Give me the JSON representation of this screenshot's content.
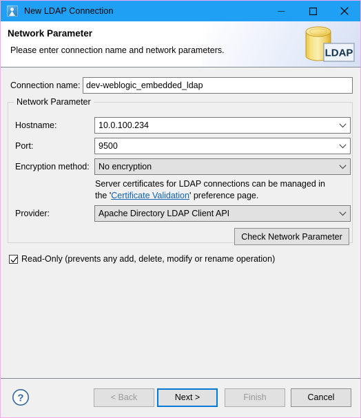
{
  "window": {
    "title": "New LDAP Connection",
    "app_icon": "ldap-app-icon",
    "controls": {
      "minimize": "minimize-icon",
      "maximize": "maximize-icon",
      "close": "close-icon"
    },
    "titlebar_color": "#1fa0f5",
    "border_color": "#f7a8f0"
  },
  "header": {
    "title": "Network Parameter",
    "subtitle": "Please enter connection name and network parameters.",
    "banner_label": "LDAP",
    "banner_icon": "ldap-database-icon"
  },
  "form": {
    "connection_name": {
      "label": "Connection name:",
      "value": "dev-weblogic_embedded_ldap",
      "placeholder": ""
    },
    "group_title": "Network Parameter",
    "hostname": {
      "label": "Hostname:",
      "value": "10.0.100.234"
    },
    "port": {
      "label": "Port:",
      "value": "9500"
    },
    "encryption_method": {
      "label": "Encryption method:",
      "value": "No encryption"
    },
    "cert_note": {
      "line1_before": "Server certificates for LDAP connections can be managed in",
      "line2_before": "the '",
      "link": "Certificate Validation",
      "line2_after": "' preference page.",
      "link_color": "#0f62b0"
    },
    "provider": {
      "label": "Provider:",
      "value": "Apache Directory LDAP Client API"
    },
    "check_button": "Check Network Parameter",
    "read_only": {
      "label": "Read-Only (prevents any add, delete, modify or rename operation)",
      "checked": true
    }
  },
  "footer": {
    "help_icon": "help-circle-icon",
    "buttons": {
      "back": "< Back",
      "next": "Next >",
      "finish": "Finish",
      "cancel": "Cancel"
    }
  }
}
